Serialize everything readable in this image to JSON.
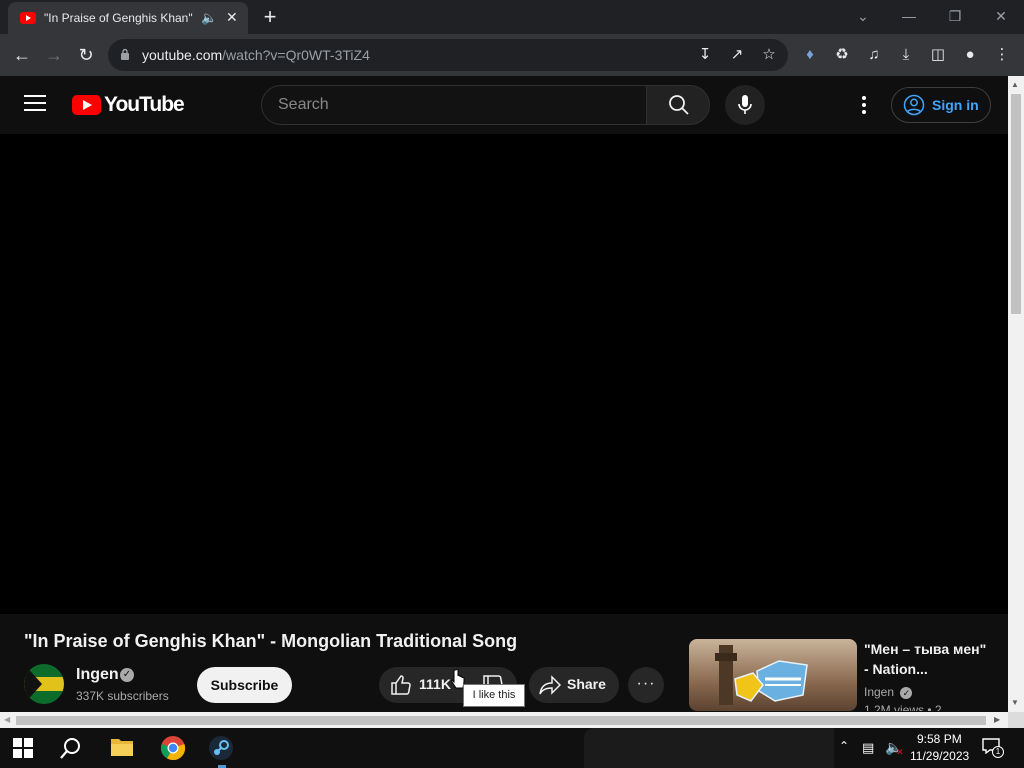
{
  "browser": {
    "tab_title": "\"In Praise of Genghis Khan\"",
    "url_domain": "youtube.com",
    "url_path": "/watch?v=Qr0WT-3TiZ4"
  },
  "youtube": {
    "logo_text": "YouTube",
    "search_placeholder": "Search",
    "signin_label": "Sign in"
  },
  "video": {
    "title": "\"In Praise of Genghis Khan\" - Mongolian Traditional Song",
    "channel_name": "Ingen",
    "subscribers": "337K subscribers",
    "subscribe_label": "Subscribe",
    "like_count": "111K",
    "like_tooltip": "I like this",
    "share_label": "Share"
  },
  "recommendation": {
    "title": "\"Мен – тыва мен\" - Nation...",
    "channel": "Ingen",
    "meta": "1.2M views • 2"
  },
  "taskbar": {
    "time": "9:58 PM",
    "date": "11/29/2023",
    "notification_count": "1"
  }
}
